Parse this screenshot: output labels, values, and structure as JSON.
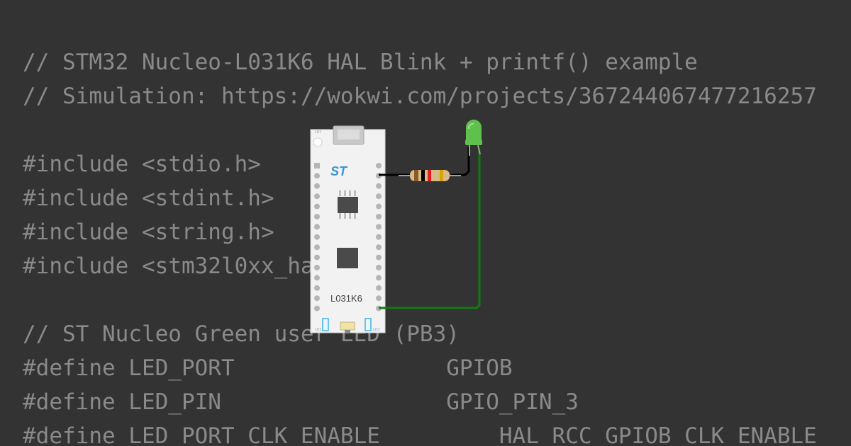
{
  "code": {
    "lines": [
      "",
      "// STM32 Nucleo-L031K6 HAL Blink + printf() example",
      "// Simulation: https://wokwi.com/projects/367244067477216257",
      "",
      "#include <stdio.h>",
      "#include <stdint.h>",
      "#include <string.h>",
      "#include <stm32l0xx_hal.h>",
      "",
      "// ST Nucleo Green user LED (PB3)",
      "#define LED_PORT                GPIOB",
      "#define LED_PIN                 GPIO_PIN_3",
      "#define LED_PORT_CLK_ENABLE       __HAL_RCC_GPIOB_CLK_ENABLE"
    ]
  },
  "circuit": {
    "board": {
      "label": "L031K6",
      "logo": "ST",
      "top_tag": "LD1",
      "led_tags": [
        "LD2",
        "LD3"
      ]
    },
    "colors": {
      "background": "#333333",
      "code_text": "#8a8a8a",
      "board": "#f2f2f2",
      "led": "#5fc04d",
      "wire_black": "#000000",
      "wire_green": "#117a13",
      "resistor_body": "#d9b98a"
    }
  }
}
